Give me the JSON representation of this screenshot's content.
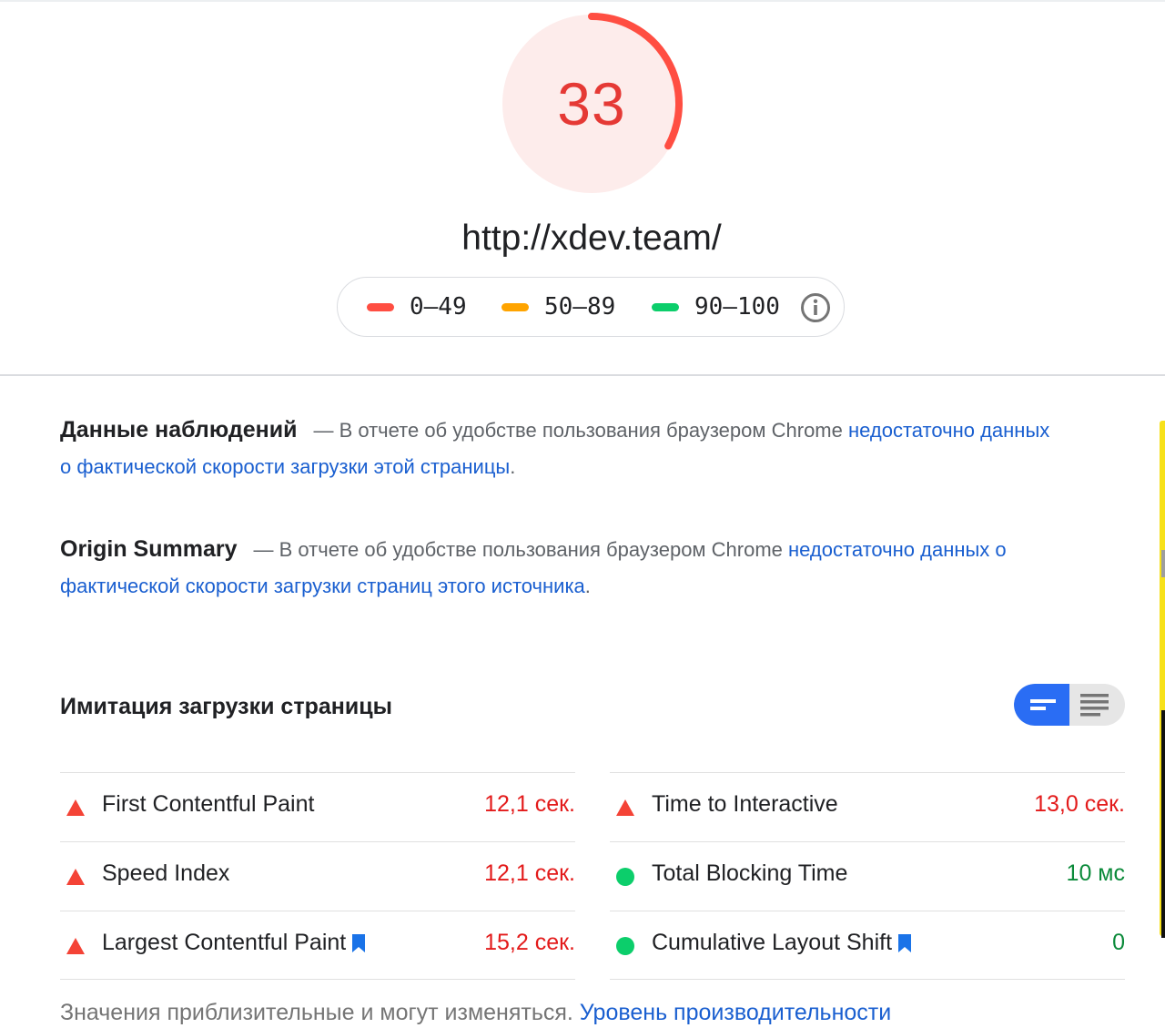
{
  "score": {
    "value": "33",
    "fraction": 0.33,
    "color": "#ff4e42",
    "track_fill": "#fdeceb"
  },
  "url": "http://xdev.team/",
  "legend": [
    {
      "label": "0–49",
      "color": "#ff4e42"
    },
    {
      "label": "50–89",
      "color": "#ffa400"
    },
    {
      "label": "90–100",
      "color": "#0cce6b"
    }
  ],
  "field_data": {
    "heading": "Данные наблюдений",
    "dash_text": "— В отчете об удобстве пользования браузером Chrome ",
    "link": "недостаточно данных о фактической скорости загрузки этой страницы",
    "tail": "."
  },
  "origin_summary": {
    "heading": "Origin Summary",
    "dash_text": "— В отчете об удобстве пользования браузером Chrome ",
    "link": "недостаточно данных о фактической скорости загрузки страниц этого источника",
    "tail": "."
  },
  "lab": {
    "title": "Имитация загрузки страницы",
    "view_toggle": {
      "active": "compact",
      "icons": [
        "compact-view-icon",
        "list-view-icon"
      ]
    }
  },
  "metrics_left": [
    {
      "name": "First Contentful Paint",
      "value": "12,1 сек.",
      "status": "fail",
      "bookmark": false
    },
    {
      "name": "Speed Index",
      "value": "12,1 сек.",
      "status": "fail",
      "bookmark": false
    },
    {
      "name": "Largest Contentful Paint",
      "value": "15,2 сек.",
      "status": "fail",
      "bookmark": true
    }
  ],
  "metrics_right": [
    {
      "name": "Time to Interactive",
      "value": "13,0 сек.",
      "status": "fail",
      "bookmark": false
    },
    {
      "name": "Total Blocking Time",
      "value": "10 мс",
      "status": "pass",
      "bookmark": false
    },
    {
      "name": "Cumulative Layout Shift",
      "value": "0",
      "status": "pass",
      "bookmark": true
    }
  ],
  "footnote": {
    "text": "Значения приблизительные и могут изменяться. ",
    "link": "Уровень производительности"
  },
  "colors": {
    "fail": "#ff4e42",
    "pass": "#0cce6b",
    "link": "#1a5fd0",
    "accent": "#2a6df4"
  }
}
